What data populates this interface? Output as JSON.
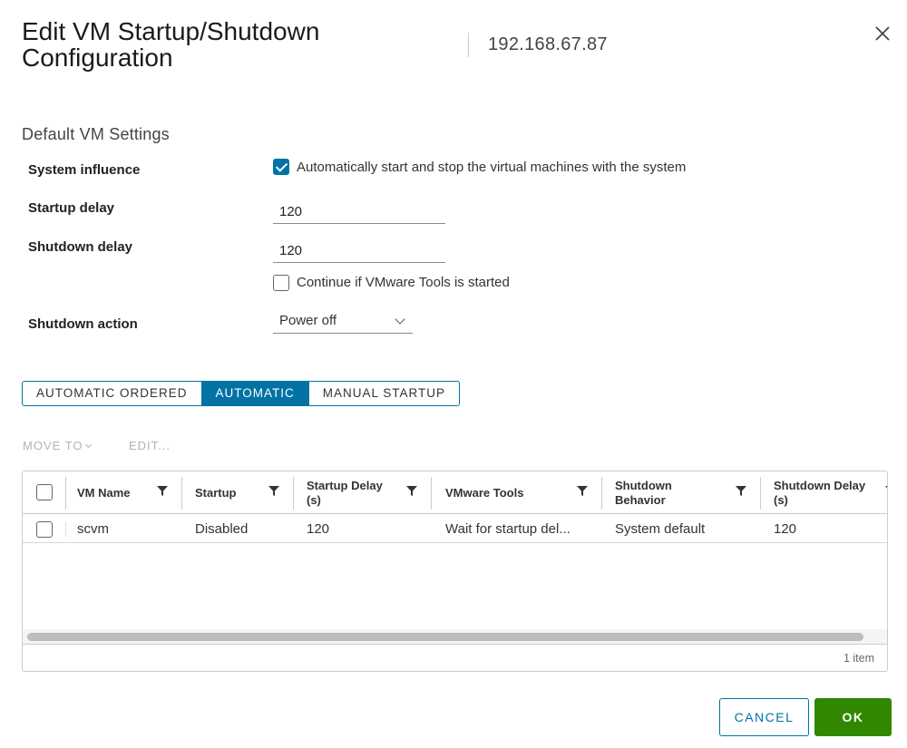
{
  "dialog": {
    "title": "Edit VM Startup/Shutdown Configuration",
    "host": "192.168.67.87"
  },
  "defaults": {
    "section_title": "Default VM Settings",
    "system_influence_label": "System influence",
    "auto_start_checked": true,
    "auto_start_text": "Automatically start and stop the virtual machines with the system",
    "startup_delay_label": "Startup delay",
    "startup_delay_value": "120",
    "shutdown_delay_label": "Shutdown delay",
    "shutdown_delay_value": "120",
    "continue_checked": false,
    "continue_text": "Continue if VMware Tools is started",
    "shutdown_action_label": "Shutdown action",
    "shutdown_action_value": "Power off"
  },
  "tabs": [
    {
      "label": "AUTOMATIC ORDERED",
      "active": false
    },
    {
      "label": "AUTOMATIC",
      "active": true
    },
    {
      "label": "MANUAL STARTUP",
      "active": false
    }
  ],
  "actions": {
    "move_to": "MOVE TO",
    "edit": "EDIT..."
  },
  "grid": {
    "columns": [
      "VM Name",
      "Startup",
      "Startup Delay (s)",
      "VMware Tools",
      "Shutdown Behavior",
      "Shutdown Delay (s)"
    ],
    "rows": [
      {
        "vm_name": "scvm",
        "startup": "Disabled",
        "startup_delay": "120",
        "vmware_tools": "Wait for startup del...",
        "shutdown_behavior": "System default",
        "shutdown_delay": "120"
      }
    ],
    "item_count": "1 item"
  },
  "buttons": {
    "cancel": "CANCEL",
    "ok": "OK"
  },
  "colors": {
    "accent": "#0072a3",
    "ok_green": "#318700"
  }
}
